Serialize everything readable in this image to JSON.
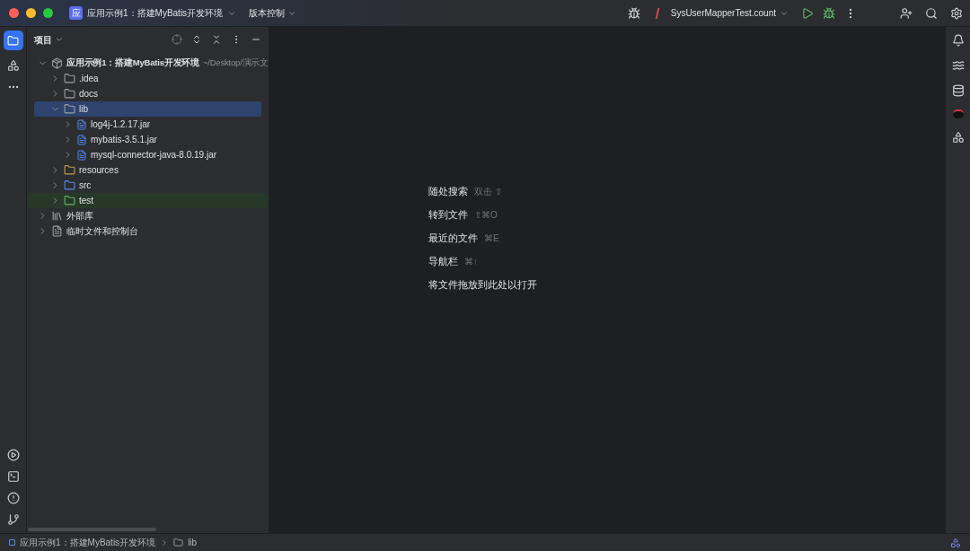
{
  "title_bar": {
    "project_badge": "应",
    "project": "应用示例1：搭建MyBatis开发环境",
    "vcs": "版本控制",
    "run_config": "SysUserMapperTest.count"
  },
  "project_panel": {
    "title": "项目",
    "tree": [
      {
        "label": "应用示例1：搭建MyBatis开发环境",
        "suffix": "~/Desktop/演示文",
        "kind": "module",
        "expanded": true,
        "selected": false,
        "children": [
          {
            "label": ".idea",
            "kind": "folder",
            "expanded": false,
            "selected": false
          },
          {
            "label": "docs",
            "kind": "folder",
            "expanded": false,
            "selected": false
          },
          {
            "label": "lib",
            "kind": "folder",
            "expanded": true,
            "selected": true,
            "children": [
              {
                "label": "log4j-1.2.17.jar",
                "kind": "jar",
                "expanded": false,
                "selected": false
              },
              {
                "label": "mybatis-3.5.1.jar",
                "kind": "jar",
                "expanded": false,
                "selected": false
              },
              {
                "label": "mysql-connector-java-8.0.19.jar",
                "kind": "jar",
                "expanded": false,
                "selected": false
              }
            ]
          },
          {
            "label": "resources",
            "kind": "resources",
            "expanded": false,
            "selected": false
          },
          {
            "label": "src",
            "kind": "source",
            "expanded": false,
            "selected": false
          },
          {
            "label": "test",
            "kind": "test",
            "expanded": false,
            "selected": false
          }
        ]
      },
      {
        "label": "外部库",
        "kind": "library",
        "expanded": false,
        "selected": false
      },
      {
        "label": "临时文件和控制台",
        "kind": "scratch",
        "expanded": false,
        "selected": false
      }
    ]
  },
  "editor_hints": [
    {
      "label": "随处搜索",
      "shortcut": "双击 ⇧"
    },
    {
      "label": "转到文件",
      "shortcut": "⇧⌘O"
    },
    {
      "label": "最近的文件",
      "shortcut": "⌘E"
    },
    {
      "label": "导航栏",
      "shortcut": "⌘↑"
    },
    {
      "label": "将文件拖放到此处以打开"
    }
  ],
  "status_bar": {
    "breadcrumbs": [
      {
        "label": "应用示例1：搭建MyBatis开发环境",
        "kind": "module"
      },
      {
        "label": "lib",
        "kind": "folder"
      }
    ]
  }
}
